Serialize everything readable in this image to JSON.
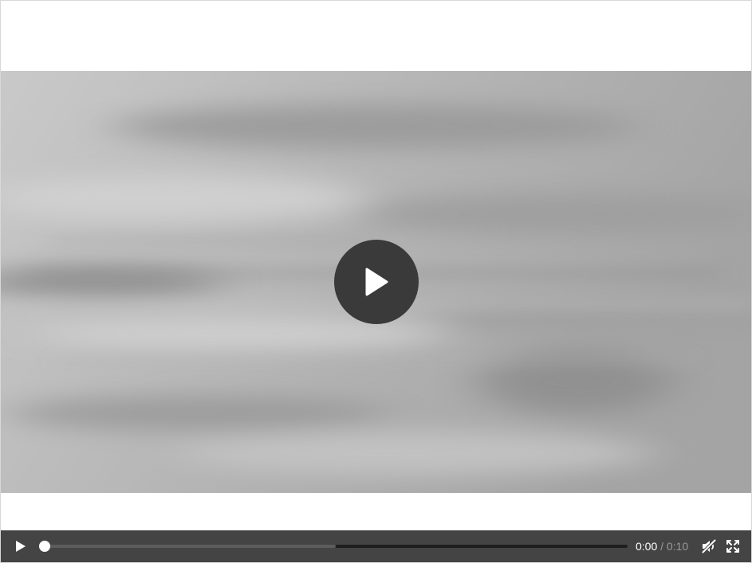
{
  "player": {
    "current_time": "0:00",
    "separator": "/",
    "duration": "0:10",
    "progress": 0.0,
    "buffered": 0.5,
    "muted": true
  },
  "icons": {
    "big_play": "play-circle-icon",
    "play": "play-icon",
    "volume": "volume-muted-icon",
    "fullscreen": "fullscreen-icon"
  },
  "colors": {
    "control_bar": "#444444",
    "big_play_button": "#3a3a3a",
    "seek_track": "#1e1e1e",
    "seek_buffered": "#5c5c5c",
    "thumb": "#ffffff"
  }
}
